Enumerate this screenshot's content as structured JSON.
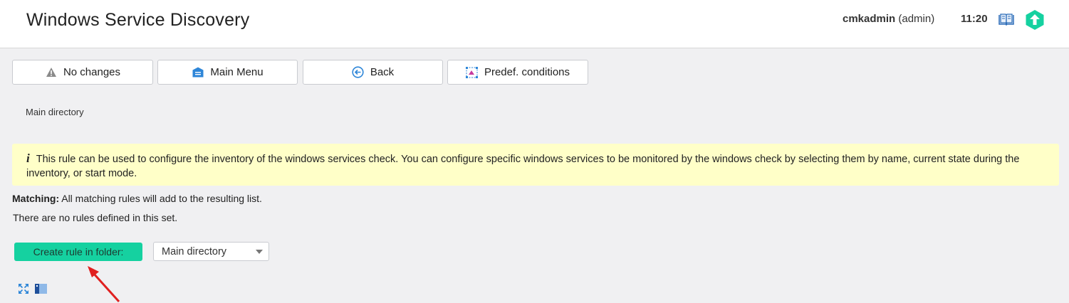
{
  "header": {
    "title": "Windows Service Discovery",
    "user_name": "cmkadmin",
    "user_role": "(admin)",
    "time": "11:20",
    "book_icon": "book-icon",
    "logo_icon": "checkmk-logo-icon"
  },
  "toolbar": {
    "buttons": [
      {
        "label": "No changes",
        "icon": "warning-icon"
      },
      {
        "label": "Main Menu",
        "icon": "home-icon"
      },
      {
        "label": "Back",
        "icon": "back-icon"
      },
      {
        "label": "Predef. conditions",
        "icon": "predefined-conditions-icon"
      }
    ]
  },
  "breadcrumb": "Main directory",
  "info": {
    "icon": "i",
    "text": "This rule can be used to configure the inventory of the windows services check. You can configure specific windows services to be monitored by the windows check by selecting them by name, current state during the inventory, or start mode."
  },
  "matching": {
    "label": "Matching:",
    "text": " All matching rules will add to the resulting list."
  },
  "no_rules_text": "There are no rules defined in this set.",
  "create": {
    "button_label": "Create rule in folder:",
    "folder_selected": "Main directory"
  },
  "colors": {
    "accent": "#15d1a0",
    "info_bg": "#ffffc8",
    "page_bg": "#f0f0f2",
    "annotation_arrow": "#e02020"
  }
}
